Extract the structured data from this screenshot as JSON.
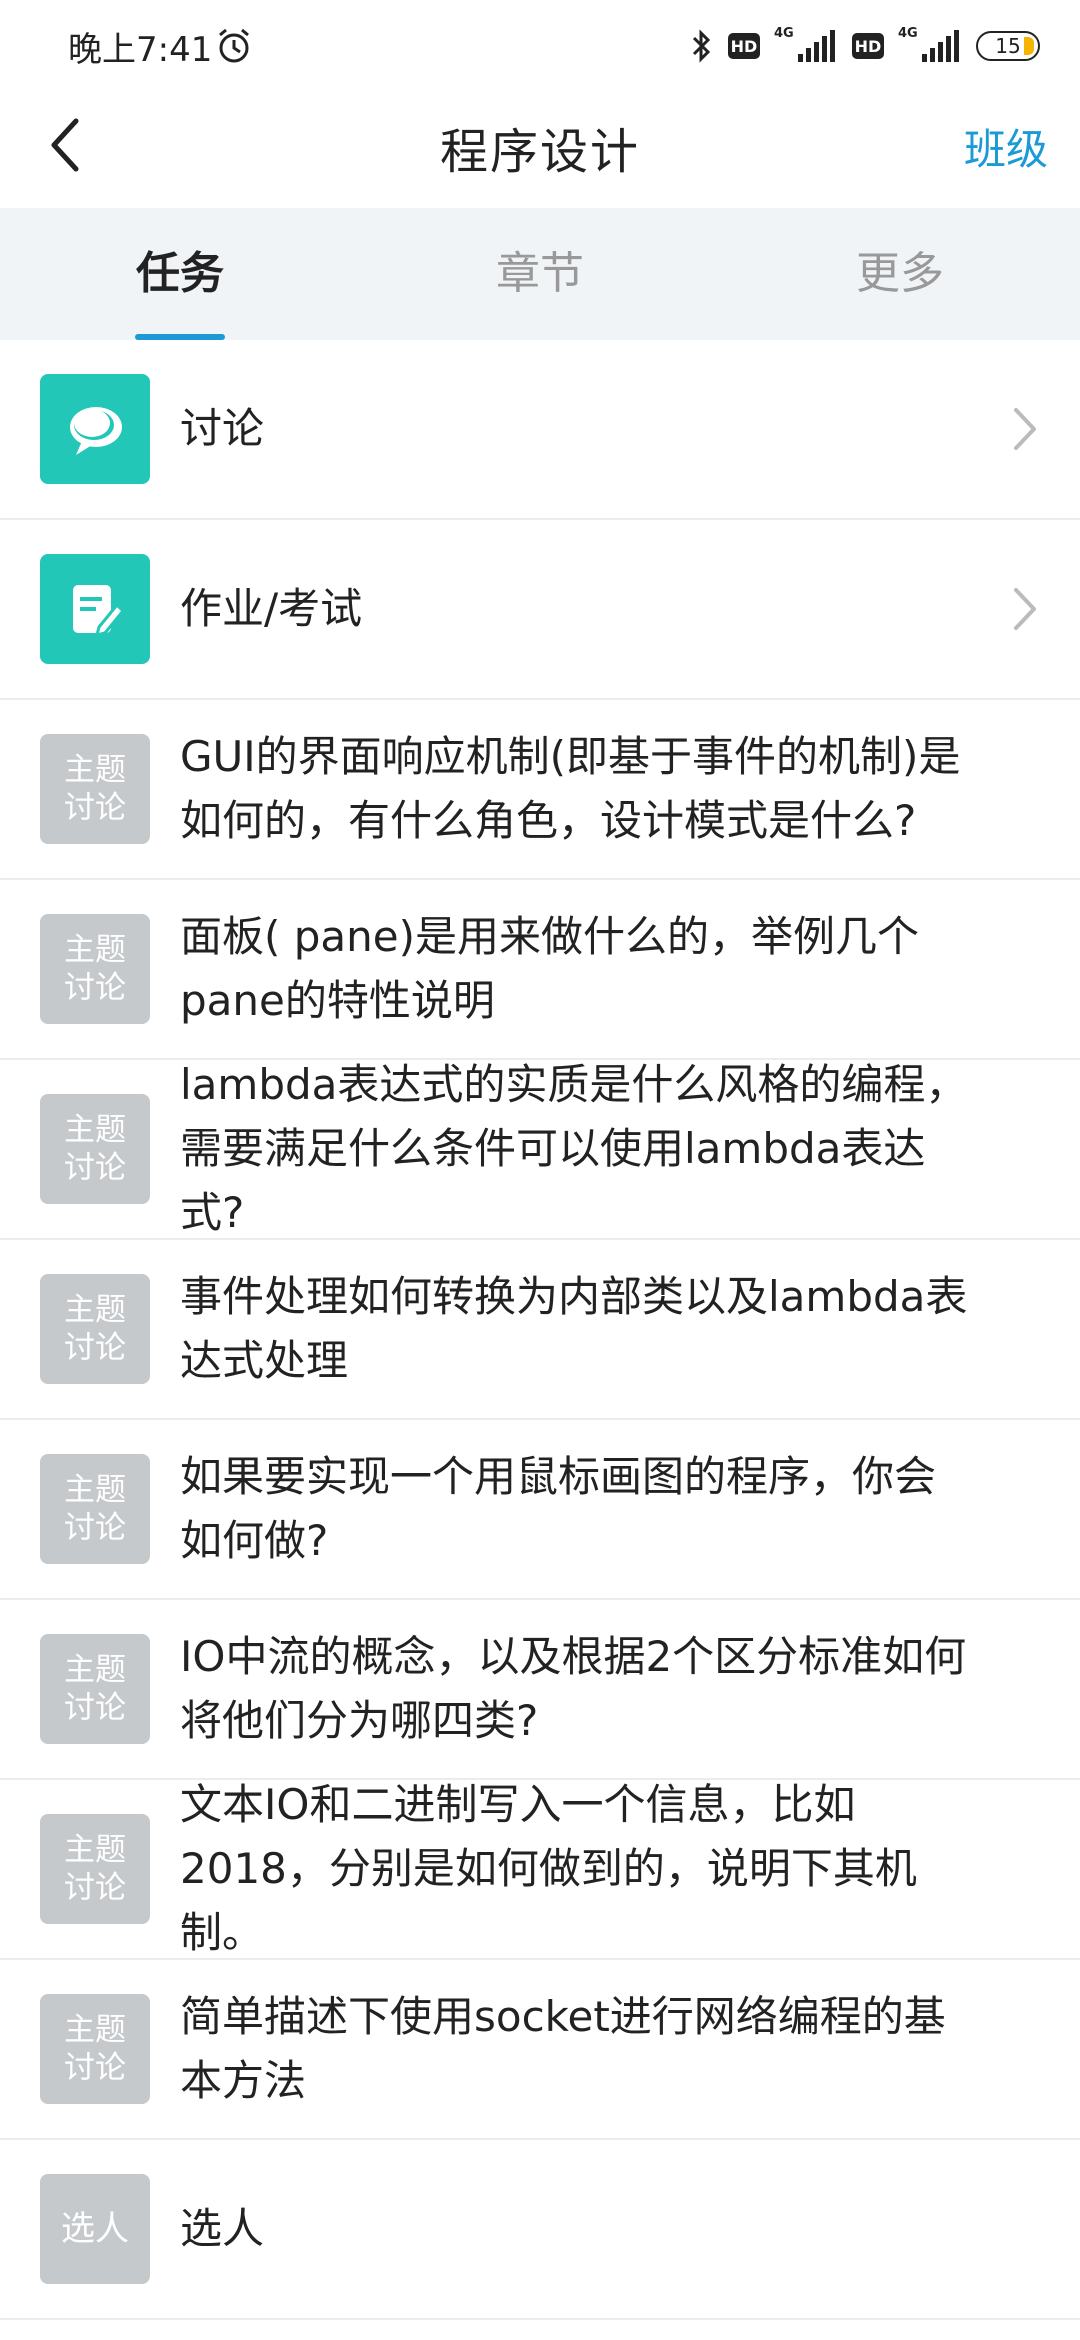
{
  "status_bar": {
    "time": "晚上7:41",
    "hd1": "HD",
    "net1": "4G",
    "hd2": "HD",
    "net2": "4G",
    "battery": "15"
  },
  "header": {
    "title": "程序设计",
    "right_link": "班级"
  },
  "tabs": [
    {
      "label": "任务",
      "active": true
    },
    {
      "label": "章节",
      "active": false
    },
    {
      "label": "更多",
      "active": false
    }
  ],
  "items": [
    {
      "icon": "discussion-icon",
      "title": "讨论"
    },
    {
      "icon": "assignment-icon",
      "title": "作业/考试"
    },
    {
      "badge": "主题\n讨论",
      "title": "GUI的界面响应机制(即基于事件的机制)是如何的，有什么角色，设计模式是什么?"
    },
    {
      "badge": "主题\n讨论",
      "title": "面板( pane)是用来做什么的，举例几个pane的特性说明"
    },
    {
      "badge": "主题\n讨论",
      "title": "lambda表达式的实质是什么风格的编程，需要满足什么条件可以使用lambda表达式?"
    },
    {
      "badge": "主题\n讨论",
      "title": "事件处理如何转换为内部类以及lambda表达式处理"
    },
    {
      "badge": "主题\n讨论",
      "title": "如果要实现一个用鼠标画图的程序，你会如何做?"
    },
    {
      "badge": "主题\n讨论",
      "title": "IO中流的概念，以及根据2个区分标准如何将他们分为哪四类?"
    },
    {
      "badge": "主题\n讨论",
      "title": "文本IO和二进制写入一个信息，比如2018，分别是如何做到的，说明下其机制。"
    },
    {
      "badge": "主题\n讨论",
      "title": "简单描述下使用socket进行网络编程的基本方法"
    },
    {
      "badge": "选人",
      "title": "选人"
    }
  ],
  "colors": {
    "accent": "#1b9ad6",
    "teal": "#22c7b8",
    "badge_gray": "#c5c9cc"
  }
}
